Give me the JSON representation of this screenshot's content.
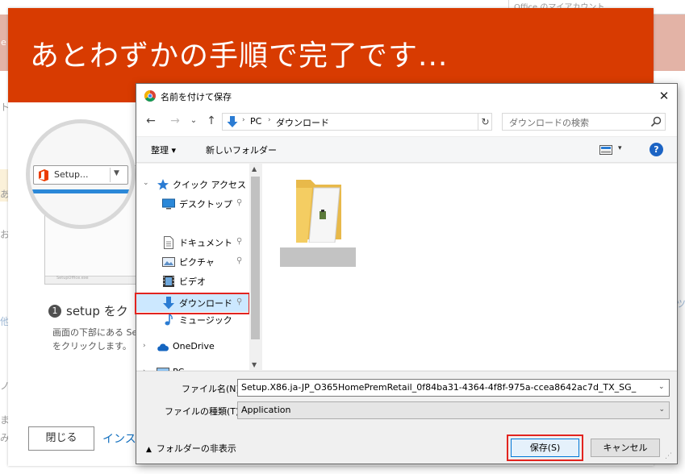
{
  "background": {
    "top_right_text": "Office のマイアカウント",
    "left_fragments": [
      "e",
      "ト",
      "あ",
      "お",
      "他",
      "ノ",
      "ま",
      "み"
    ],
    "right_fragment": "ツ"
  },
  "office_panel": {
    "heading": "あとわずかの手順で完了です...",
    "illustration": {
      "button_label": "Setup...",
      "screen_caption": "SetupOffice.exe"
    },
    "step": {
      "number": "1",
      "title": "setup をク",
      "description_lines": [
        "画面の下部にある Se",
        "をクリックします。"
      ]
    },
    "close_button": "閉じる",
    "install_link": "インス"
  },
  "save_dialog": {
    "title": "名前を付けて保存",
    "close_glyph": "✕",
    "nav": {
      "back": "←",
      "forward": "→",
      "recent": "⌄",
      "up": "↑"
    },
    "address": {
      "segments": [
        "PC",
        "ダウンロード"
      ],
      "dropdown": "⌄",
      "refresh": "↻"
    },
    "search_placeholder": "ダウンロードの検索",
    "toolbar": {
      "organize": "整理 ▾",
      "new_folder": "新しいフォルダー",
      "view_dropdown": "▾",
      "help": "?"
    },
    "nav_pane": {
      "quick_access": "クイック アクセス",
      "items": [
        {
          "label": "デスクトップ",
          "icon": "desktop-icon",
          "pinned": true
        },
        {
          "label": "ダウンロード",
          "icon": "download-icon",
          "pinned": true,
          "selected": true
        },
        {
          "label": "ドキュメント",
          "icon": "document-icon",
          "pinned": true
        },
        {
          "label": "ピクチャ",
          "icon": "pictures-icon",
          "pinned": true
        },
        {
          "label": "ビデオ",
          "icon": "video-icon",
          "pinned": false
        },
        {
          "label": "ミュージック",
          "icon": "music-icon",
          "pinned": false
        }
      ],
      "onedrive": "OneDrive",
      "pc": "PC",
      "pin_glyph": "📌",
      "expand_glyph": "›",
      "collapse_glyph": "⌄"
    },
    "form": {
      "filename_label": "ファイル名(N):",
      "filename_value": "Setup.X86.ja-JP_O365HomePremRetail_0f84ba31-4364-4f8f-975a-ccea8642ac7d_TX_SG_",
      "filetype_label": "ファイルの種類(T):",
      "filetype_value": "Application",
      "hide_folders": "フォルダーの非表示",
      "save": "保存(S)",
      "cancel": "キャンセル"
    },
    "colors": {
      "selected": "#cce8ff",
      "highlight": "#e2241f",
      "accent": "#0078d7"
    }
  }
}
